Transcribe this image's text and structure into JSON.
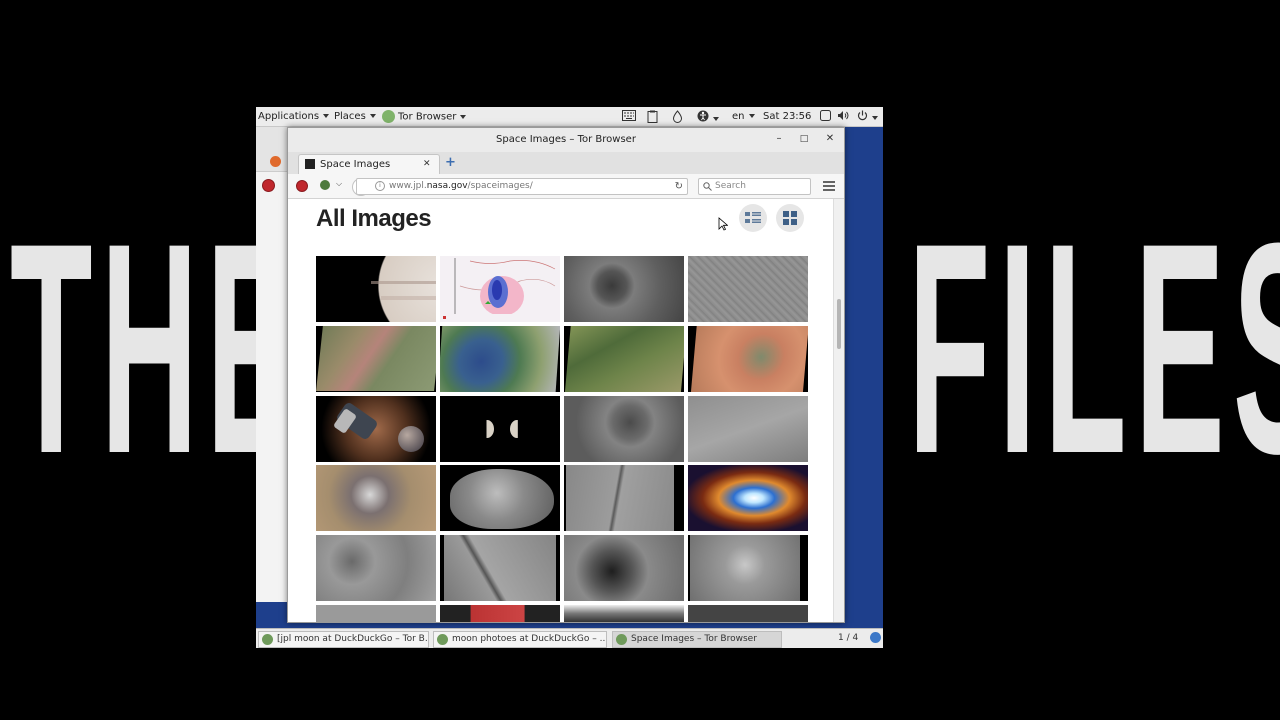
{
  "overlay": {
    "left_text": "THE",
    "right_text": "FILES"
  },
  "topbar": {
    "applications": "Applications",
    "places": "Places",
    "app_name": "Tor Browser",
    "language": "en",
    "clock": "Sat 23:56"
  },
  "window": {
    "title": "Space Images – Tor Browser",
    "minimize": "–",
    "maximize": "□",
    "close": "✕"
  },
  "tab": {
    "label": "Space Images",
    "close": "✕",
    "new_tab": "+"
  },
  "navbar": {
    "url_prefix": "www.jpl.",
    "url_domain": "nasa.gov",
    "url_path": "/spaceimages/",
    "search_placeholder": "Search"
  },
  "page": {
    "title": "All Images"
  },
  "taskbar": {
    "tasks": [
      {
        "label": "[jpl moon at DuckDuckGo – Tor B..."
      },
      {
        "label": "moon photoes at DuckDuckGo – ..."
      },
      {
        "label": "Space Images – Tor Browser"
      }
    ],
    "workspace": "1 / 4"
  }
}
